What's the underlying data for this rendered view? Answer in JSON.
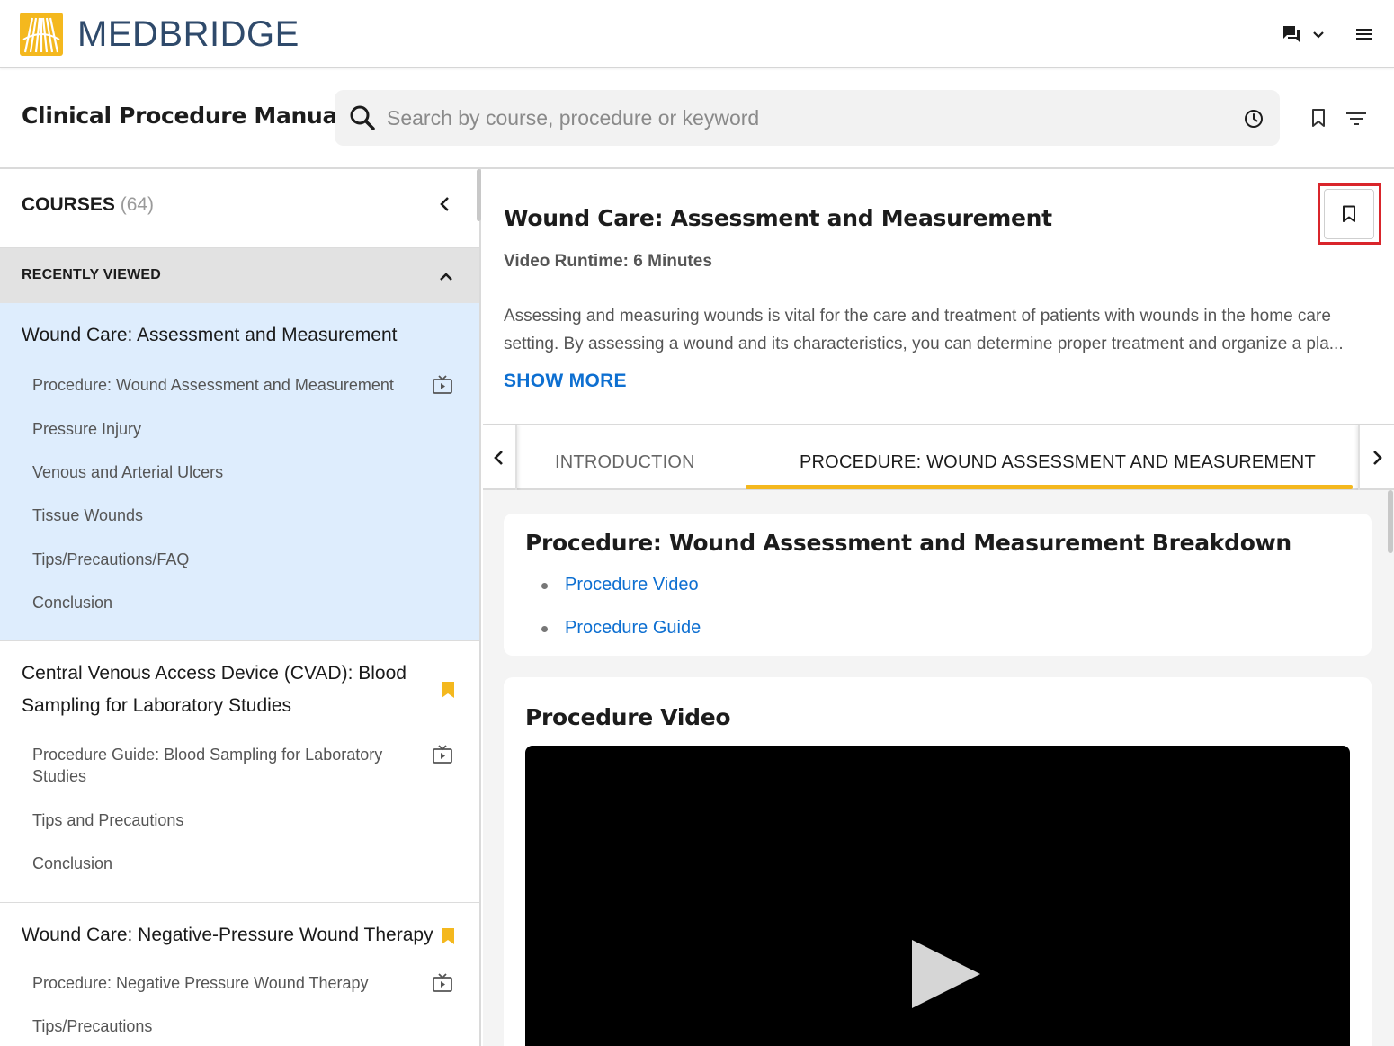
{
  "app": {
    "brand": "MEDBRIDGE",
    "page_title": "Clinical Procedure Manual"
  },
  "search": {
    "placeholder": "Search by course, procedure or keyword",
    "value": ""
  },
  "sidebar": {
    "courses_label": "COURSES",
    "courses_count": "(64)",
    "recently_viewed_label": "RECENTLY VIEWED",
    "courses": [
      {
        "title": "Wound Care: Assessment and Measurement",
        "active": true,
        "bookmarked": false,
        "items": [
          {
            "label": "Procedure: Wound Assessment and Measurement",
            "icon": "video-icon"
          },
          {
            "label": "Pressure Injury"
          },
          {
            "label": "Venous and Arterial Ulcers"
          },
          {
            "label": "Tissue Wounds"
          },
          {
            "label": "Tips/Precautions/FAQ"
          },
          {
            "label": "Conclusion"
          }
        ]
      },
      {
        "title": "Central Venous Access Device (CVAD): Blood Sampling for Laboratory Studies",
        "active": false,
        "bookmarked": true,
        "items": [
          {
            "label": "Procedure Guide: Blood Sampling for Laboratory Studies",
            "icon": "video-icon"
          },
          {
            "label": "Tips and Precautions"
          },
          {
            "label": "Conclusion"
          }
        ]
      },
      {
        "title": "Wound Care: Negative-Pressure Wound Therapy",
        "active": false,
        "bookmarked": true,
        "items": [
          {
            "label": "Procedure: Negative Pressure Wound Therapy",
            "icon": "video-icon"
          },
          {
            "label": "Tips/Precautions"
          }
        ]
      }
    ]
  },
  "main": {
    "course_title": "Wound Care: Assessment and Measurement",
    "runtime": "Video Runtime: 6 Minutes",
    "description_line1": "Assessing and measuring wounds is vital for the care and treatment of patients with wounds in the home care",
    "description_line2": "setting. By assessing a wound and its characteristics, you can determine proper treatment and organize a pla...",
    "show_more": "SHOW MORE",
    "tabs": [
      {
        "label": "INTRODUCTION",
        "active": false
      },
      {
        "label": "PROCEDURE: WOUND ASSESSMENT AND MEASUREMENT",
        "active": true
      }
    ],
    "breakdown": {
      "title": "Procedure: Wound Assessment and Measurement Breakdown",
      "links": [
        "Procedure Video",
        "Procedure Guide"
      ]
    },
    "video_section": {
      "title": "Procedure Video"
    }
  },
  "colors": {
    "brand_navy": "#2f4a6b",
    "brand_yellow": "#f4b81e",
    "link_blue": "#0d6fd1",
    "active_course_bg": "#deedfd",
    "highlight_red": "#d9252b"
  }
}
